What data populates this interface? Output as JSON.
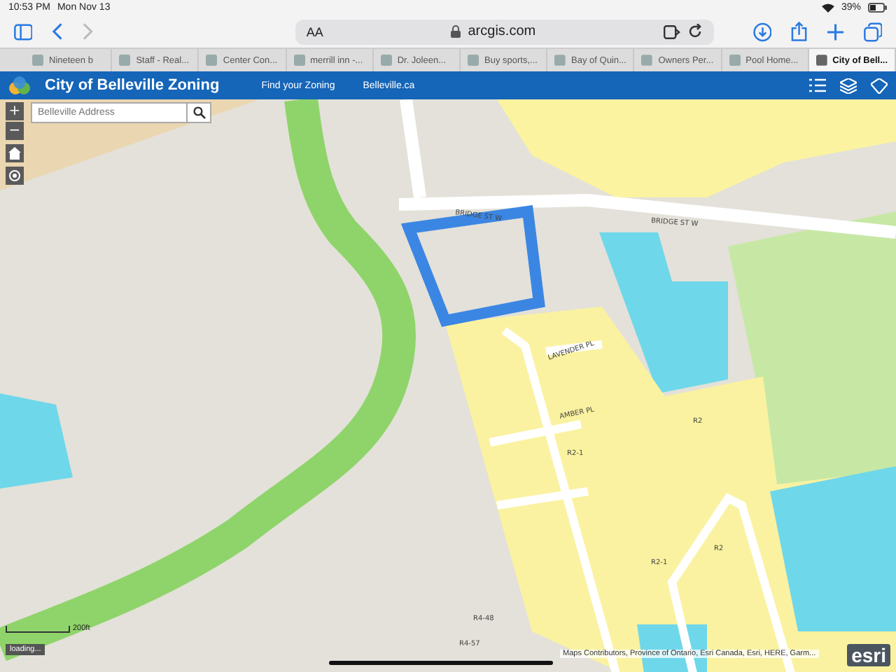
{
  "status_bar": {
    "time": "10:53 PM",
    "date": "Mon Nov 13",
    "battery": "39%"
  },
  "browser": {
    "text_size": "AA",
    "address": "arcgis.com",
    "tabs": [
      {
        "label": "Nineteen b",
        "selected": false
      },
      {
        "label": "Staff - Real...",
        "selected": false
      },
      {
        "label": "Center Con...",
        "selected": false
      },
      {
        "label": "merrill inn -...",
        "selected": false
      },
      {
        "label": "Dr. Joleen...",
        "selected": false
      },
      {
        "label": "Buy sports,...",
        "selected": false
      },
      {
        "label": "Bay of Quin...",
        "selected": false
      },
      {
        "label": "Owners Per...",
        "selected": false
      },
      {
        "label": "Pool Home...",
        "selected": false
      },
      {
        "label": "City of Bell...",
        "selected": true
      }
    ]
  },
  "app": {
    "title": "City of Belleville Zoning",
    "nav": [
      "Find your Zoning",
      "Belleville.ca"
    ]
  },
  "map": {
    "zoom_in": "+",
    "zoom_out": "−",
    "search": {
      "placeholder": "Belleville Address"
    },
    "labels": [
      "BRIDGE ST W",
      "BRIDGE ST W",
      "LAVENDER PL",
      "AMBER PL",
      "R2",
      "R2-1",
      "R2",
      "R2-1",
      "R4-48",
      "R4-57"
    ],
    "scale": "200ft",
    "loading": "loading...",
    "attribution": "Maps Contributors, Province of Ontario, Esri Canada, Esri, HERE, Garm...",
    "logo": "esri"
  }
}
